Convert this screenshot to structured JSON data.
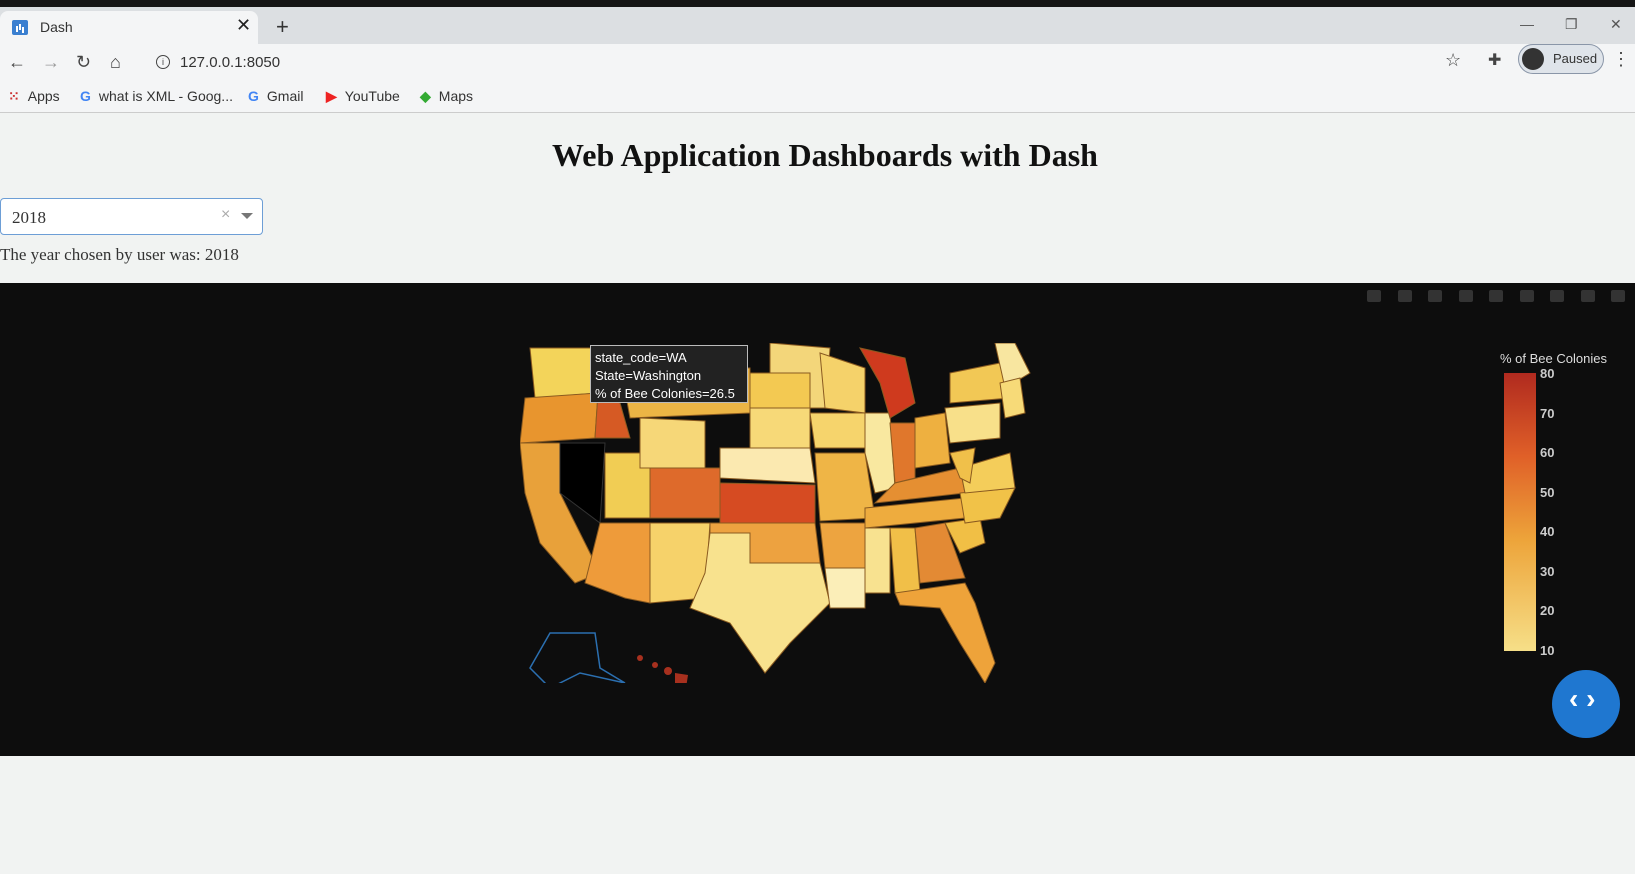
{
  "browser": {
    "tab_title": "Dash",
    "new_tab_symbol": "+",
    "url": "127.0.0.1:8050",
    "profile_label": "Paused",
    "bookmarks": [
      {
        "label": "Apps",
        "icon": "apps-grid-icon"
      },
      {
        "label": "what is XML - Goog...",
        "icon": "google-icon"
      },
      {
        "label": "Gmail",
        "icon": "google-icon"
      },
      {
        "label": "YouTube",
        "icon": "youtube-icon"
      },
      {
        "label": "Maps",
        "icon": "maps-icon"
      }
    ]
  },
  "page": {
    "title": "Web Application Dashboards with Dash",
    "dropdown": {
      "value": "2018",
      "clear_symbol": "×"
    },
    "year_text": "The year chosen by user was: 2018"
  },
  "graph": {
    "tooltip": {
      "line1": "state_code=WA",
      "line2": "State=Washington",
      "line3": "% of Bee Colonies=26.5"
    },
    "colorbar": {
      "title": "% of Bee Colonies",
      "ticks": [
        "80",
        "70",
        "60",
        "50",
        "40",
        "30",
        "20",
        "10"
      ]
    },
    "colors": {
      "background": "#0d0d0d",
      "low": "#f6df88",
      "high": "#b02a1f"
    }
  },
  "fab": {
    "symbol": "‹ ›"
  }
}
